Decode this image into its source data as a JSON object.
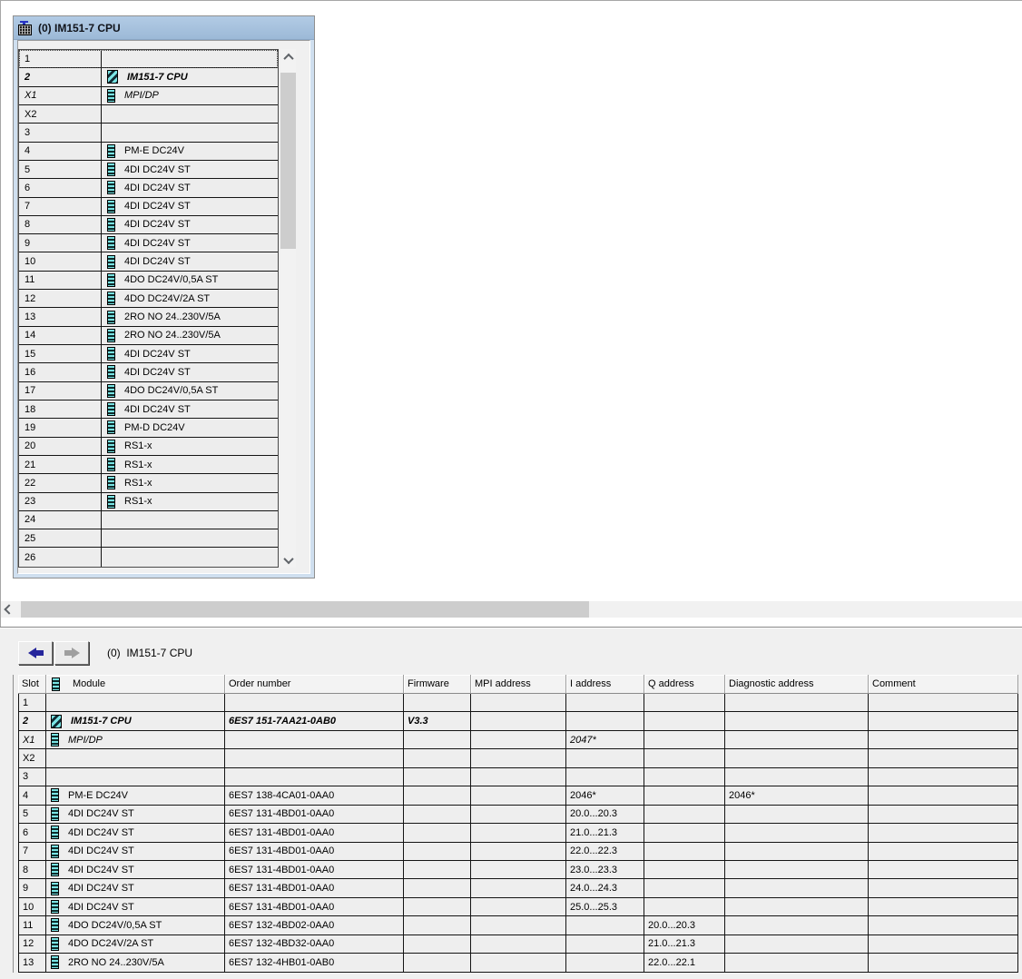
{
  "rack_window": {
    "title": "(0) IM151-7 CPU",
    "title_icon": "station-icon",
    "rows": [
      {
        "slot": "1",
        "module": "",
        "icon": "",
        "selected": true,
        "emphasis": ""
      },
      {
        "slot": "2",
        "module": "IM151-7 CPU",
        "icon": "cpu",
        "selected": false,
        "emphasis": "bold-italic"
      },
      {
        "slot": "X1",
        "module": "MPI/DP",
        "icon": "module",
        "selected": false,
        "emphasis": "italic"
      },
      {
        "slot": "X2",
        "module": "",
        "icon": "",
        "selected": false,
        "emphasis": ""
      },
      {
        "slot": "3",
        "module": "",
        "icon": "",
        "selected": false,
        "emphasis": ""
      },
      {
        "slot": "4",
        "module": "PM-E DC24V",
        "icon": "module",
        "selected": false,
        "emphasis": ""
      },
      {
        "slot": "5",
        "module": "4DI DC24V ST",
        "icon": "module",
        "selected": false,
        "emphasis": ""
      },
      {
        "slot": "6",
        "module": "4DI DC24V ST",
        "icon": "module",
        "selected": false,
        "emphasis": ""
      },
      {
        "slot": "7",
        "module": "4DI DC24V ST",
        "icon": "module",
        "selected": false,
        "emphasis": ""
      },
      {
        "slot": "8",
        "module": "4DI DC24V ST",
        "icon": "module",
        "selected": false,
        "emphasis": ""
      },
      {
        "slot": "9",
        "module": "4DI DC24V ST",
        "icon": "module",
        "selected": false,
        "emphasis": ""
      },
      {
        "slot": "10",
        "module": "4DI DC24V ST",
        "icon": "module",
        "selected": false,
        "emphasis": ""
      },
      {
        "slot": "11",
        "module": "4DO DC24V/0,5A ST",
        "icon": "module",
        "selected": false,
        "emphasis": ""
      },
      {
        "slot": "12",
        "module": "4DO DC24V/2A ST",
        "icon": "module",
        "selected": false,
        "emphasis": ""
      },
      {
        "slot": "13",
        "module": "2RO NO 24..230V/5A",
        "icon": "module",
        "selected": false,
        "emphasis": ""
      },
      {
        "slot": "14",
        "module": "2RO NO 24..230V/5A",
        "icon": "module",
        "selected": false,
        "emphasis": ""
      },
      {
        "slot": "15",
        "module": "4DI DC24V ST",
        "icon": "module",
        "selected": false,
        "emphasis": ""
      },
      {
        "slot": "16",
        "module": "4DI DC24V ST",
        "icon": "module",
        "selected": false,
        "emphasis": ""
      },
      {
        "slot": "17",
        "module": "4DO DC24V/0,5A ST",
        "icon": "module",
        "selected": false,
        "emphasis": ""
      },
      {
        "slot": "18",
        "module": "4DI DC24V ST",
        "icon": "module",
        "selected": false,
        "emphasis": ""
      },
      {
        "slot": "19",
        "module": "PM-D DC24V",
        "icon": "module",
        "selected": false,
        "emphasis": ""
      },
      {
        "slot": "20",
        "module": "RS1-x",
        "icon": "module",
        "selected": false,
        "emphasis": ""
      },
      {
        "slot": "21",
        "module": "RS1-x",
        "icon": "module",
        "selected": false,
        "emphasis": ""
      },
      {
        "slot": "22",
        "module": "RS1-x",
        "icon": "module",
        "selected": false,
        "emphasis": ""
      },
      {
        "slot": "23",
        "module": "RS1-x",
        "icon": "module",
        "selected": false,
        "emphasis": ""
      },
      {
        "slot": "24",
        "module": "",
        "icon": "",
        "selected": false,
        "emphasis": ""
      },
      {
        "slot": "25",
        "module": "",
        "icon": "",
        "selected": false,
        "emphasis": ""
      },
      {
        "slot": "26",
        "module": "",
        "icon": "",
        "selected": false,
        "emphasis": ""
      }
    ]
  },
  "detail_pane": {
    "title": "(0)  IM151-7 CPU",
    "columns": [
      "Slot",
      "Module",
      "Order number",
      "Firmware",
      "MPI address",
      "I address",
      "Q address",
      "Diagnostic address",
      "Comment"
    ],
    "rows": [
      {
        "slot": "1",
        "module": "",
        "order_number": "",
        "firmware": "",
        "mpi_address": "",
        "i_address": "",
        "q_address": "",
        "diagnostic_address": "",
        "comment": "",
        "icon": "",
        "emphasis": ""
      },
      {
        "slot": "2",
        "module": "IM151-7 CPU",
        "order_number": "6ES7 151-7AA21-0AB0",
        "firmware": "V3.3",
        "mpi_address": "",
        "i_address": "",
        "q_address": "",
        "diagnostic_address": "",
        "comment": "",
        "icon": "cpu",
        "emphasis": "bold-italic"
      },
      {
        "slot": "X1",
        "module": "MPI/DP",
        "order_number": "",
        "firmware": "",
        "mpi_address": "",
        "i_address": "2047*",
        "q_address": "",
        "diagnostic_address": "",
        "comment": "",
        "icon": "module",
        "emphasis": "italic"
      },
      {
        "slot": "X2",
        "module": "",
        "order_number": "",
        "firmware": "",
        "mpi_address": "",
        "i_address": "",
        "q_address": "",
        "diagnostic_address": "",
        "comment": "",
        "icon": "",
        "emphasis": ""
      },
      {
        "slot": "3",
        "module": "",
        "order_number": "",
        "firmware": "",
        "mpi_address": "",
        "i_address": "",
        "q_address": "",
        "diagnostic_address": "",
        "comment": "",
        "icon": "",
        "emphasis": ""
      },
      {
        "slot": "4",
        "module": "PM-E DC24V",
        "order_number": "6ES7 138-4CA01-0AA0",
        "firmware": "",
        "mpi_address": "",
        "i_address": "2046*",
        "q_address": "",
        "diagnostic_address": "2046*",
        "comment": "",
        "icon": "module",
        "emphasis": ""
      },
      {
        "slot": "5",
        "module": "4DI DC24V ST",
        "order_number": "6ES7 131-4BD01-0AA0",
        "firmware": "",
        "mpi_address": "",
        "i_address": "20.0...20.3",
        "q_address": "",
        "diagnostic_address": "",
        "comment": "",
        "icon": "module",
        "emphasis": ""
      },
      {
        "slot": "6",
        "module": "4DI DC24V ST",
        "order_number": "6ES7 131-4BD01-0AA0",
        "firmware": "",
        "mpi_address": "",
        "i_address": "21.0...21.3",
        "q_address": "",
        "diagnostic_address": "",
        "comment": "",
        "icon": "module",
        "emphasis": ""
      },
      {
        "slot": "7",
        "module": "4DI DC24V ST",
        "order_number": "6ES7 131-4BD01-0AA0",
        "firmware": "",
        "mpi_address": "",
        "i_address": "22.0...22.3",
        "q_address": "",
        "diagnostic_address": "",
        "comment": "",
        "icon": "module",
        "emphasis": ""
      },
      {
        "slot": "8",
        "module": "4DI DC24V ST",
        "order_number": "6ES7 131-4BD01-0AA0",
        "firmware": "",
        "mpi_address": "",
        "i_address": "23.0...23.3",
        "q_address": "",
        "diagnostic_address": "",
        "comment": "",
        "icon": "module",
        "emphasis": ""
      },
      {
        "slot": "9",
        "module": "4DI DC24V ST",
        "order_number": "6ES7 131-4BD01-0AA0",
        "firmware": "",
        "mpi_address": "",
        "i_address": "24.0...24.3",
        "q_address": "",
        "diagnostic_address": "",
        "comment": "",
        "icon": "module",
        "emphasis": ""
      },
      {
        "slot": "10",
        "module": "4DI DC24V ST",
        "order_number": "6ES7 131-4BD01-0AA0",
        "firmware": "",
        "mpi_address": "",
        "i_address": "25.0...25.3",
        "q_address": "",
        "diagnostic_address": "",
        "comment": "",
        "icon": "module",
        "emphasis": ""
      },
      {
        "slot": "11",
        "module": "4DO DC24V/0,5A ST",
        "order_number": "6ES7 132-4BD02-0AA0",
        "firmware": "",
        "mpi_address": "",
        "i_address": "",
        "q_address": "20.0...20.3",
        "diagnostic_address": "",
        "comment": "",
        "icon": "module",
        "emphasis": ""
      },
      {
        "slot": "12",
        "module": "4DO DC24V/2A ST",
        "order_number": "6ES7 132-4BD32-0AA0",
        "firmware": "",
        "mpi_address": "",
        "i_address": "",
        "q_address": "21.0...21.3",
        "diagnostic_address": "",
        "comment": "",
        "icon": "module",
        "emphasis": ""
      },
      {
        "slot": "13",
        "module": "2RO NO 24..230V/5A",
        "order_number": "6ES7 132-4HB01-0AB0",
        "firmware": "",
        "mpi_address": "",
        "i_address": "",
        "q_address": "22.0...22.1",
        "diagnostic_address": "",
        "comment": "",
        "icon": "module",
        "emphasis": ""
      }
    ]
  },
  "colors": {
    "titlebar_blue": "#9cb9d7",
    "module_icon_cyan": "#79e4e4",
    "nav_arrow_blue": "#26269c",
    "grid_line": "#141414",
    "cell_bg": "#eeeeee"
  }
}
